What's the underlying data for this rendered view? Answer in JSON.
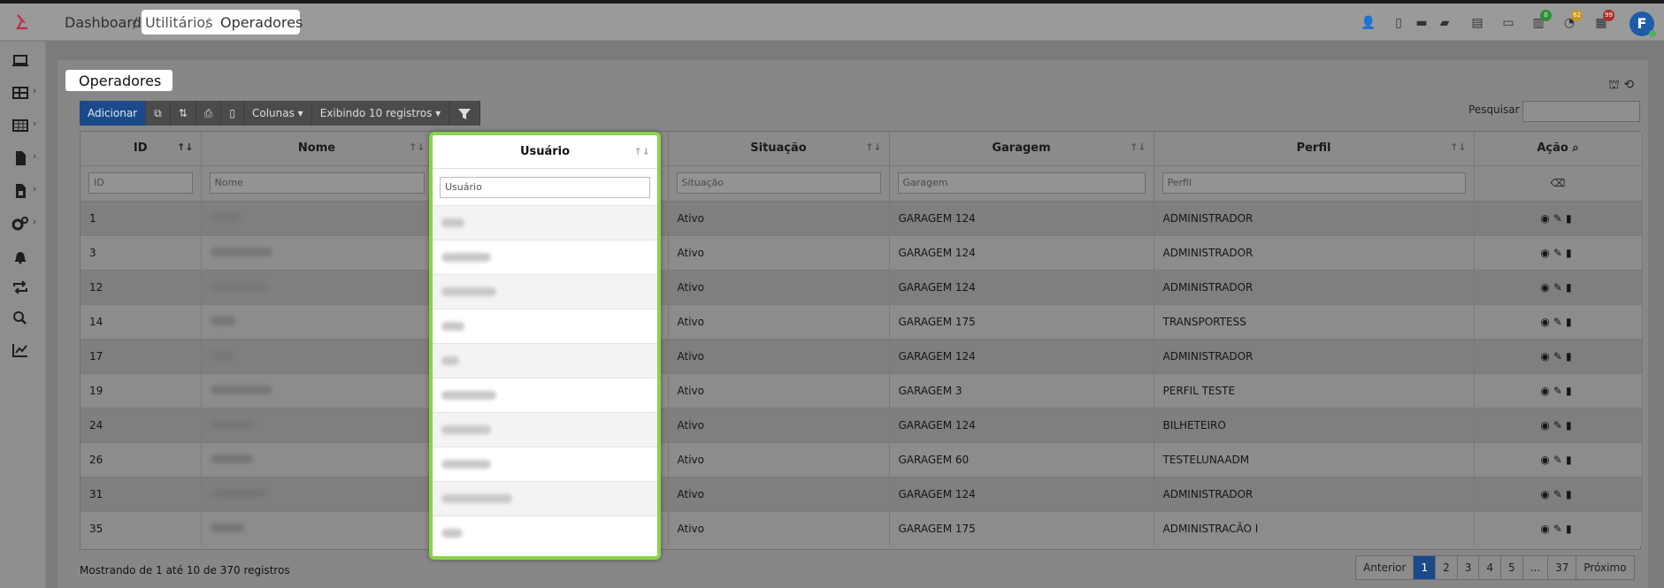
{
  "breadcrumb": {
    "home": "Dashboard",
    "section": "Utilitários",
    "current": "Operadores",
    "sep": "/"
  },
  "topbar": {
    "badges": {
      "b1": "0",
      "b2": "62",
      "b3": "99"
    },
    "avatar_initial": "F"
  },
  "page": {
    "title": "Operadores"
  },
  "toolbar": {
    "add": "Adicionar",
    "columns": "Colunas ▾",
    "showing": "Exibindo 10 registros ▾"
  },
  "search": {
    "label": "Pesquisar"
  },
  "table": {
    "headers": {
      "id": "ID",
      "nome": "Nome",
      "usuario": "Usuário",
      "situacao": "Situação",
      "garagem": "Garagem",
      "perfil": "Perfil",
      "acao": "Ação"
    },
    "filters": {
      "id": "ID",
      "nome": "Nome",
      "usuario": "Usuário",
      "situacao": "Situação",
      "garagem": "Garagem",
      "perfil": "Perfil"
    },
    "rows": [
      {
        "id": "1",
        "situacao": "Ativo",
        "garagem": "GARAGEM 124",
        "perfil": "ADMINISTRADOR"
      },
      {
        "id": "3",
        "situacao": "Ativo",
        "garagem": "GARAGEM 124",
        "perfil": "ADMINISTRADOR"
      },
      {
        "id": "12",
        "situacao": "Ativo",
        "garagem": "GARAGEM 124",
        "perfil": "ADMINISTRADOR"
      },
      {
        "id": "14",
        "situacao": "Ativo",
        "garagem": "GARAGEM 175",
        "perfil": "TRANSPORTESS"
      },
      {
        "id": "17",
        "situacao": "Ativo",
        "garagem": "GARAGEM 124",
        "perfil": "ADMINISTRADOR"
      },
      {
        "id": "19",
        "situacao": "Ativo",
        "garagem": "GARAGEM 3",
        "perfil": "PERFIL TESTE"
      },
      {
        "id": "24",
        "situacao": "Ativo",
        "garagem": "GARAGEM 124",
        "perfil": "BILHETEIRO"
      },
      {
        "id": "26",
        "situacao": "Ativo",
        "garagem": "GARAGEM 60",
        "perfil": "TESTELUNAADM"
      },
      {
        "id": "31",
        "situacao": "Ativo",
        "garagem": "GARAGEM 124",
        "perfil": "ADMINISTRADOR"
      },
      {
        "id": "35",
        "situacao": "Ativo",
        "garagem": "GARAGEM 175",
        "perfil": "ADMINISTRACÃO I"
      }
    ]
  },
  "footer": {
    "info": "Mostrando de 1 até 10 de 370 registros"
  },
  "pagination": {
    "prev": "Anterior",
    "pages": [
      "1",
      "2",
      "3",
      "4",
      "5",
      "...",
      "37"
    ],
    "next": "Próximo"
  },
  "colors": {
    "accent": "#1a4a8a",
    "highlight_border": "#8bd14a"
  }
}
